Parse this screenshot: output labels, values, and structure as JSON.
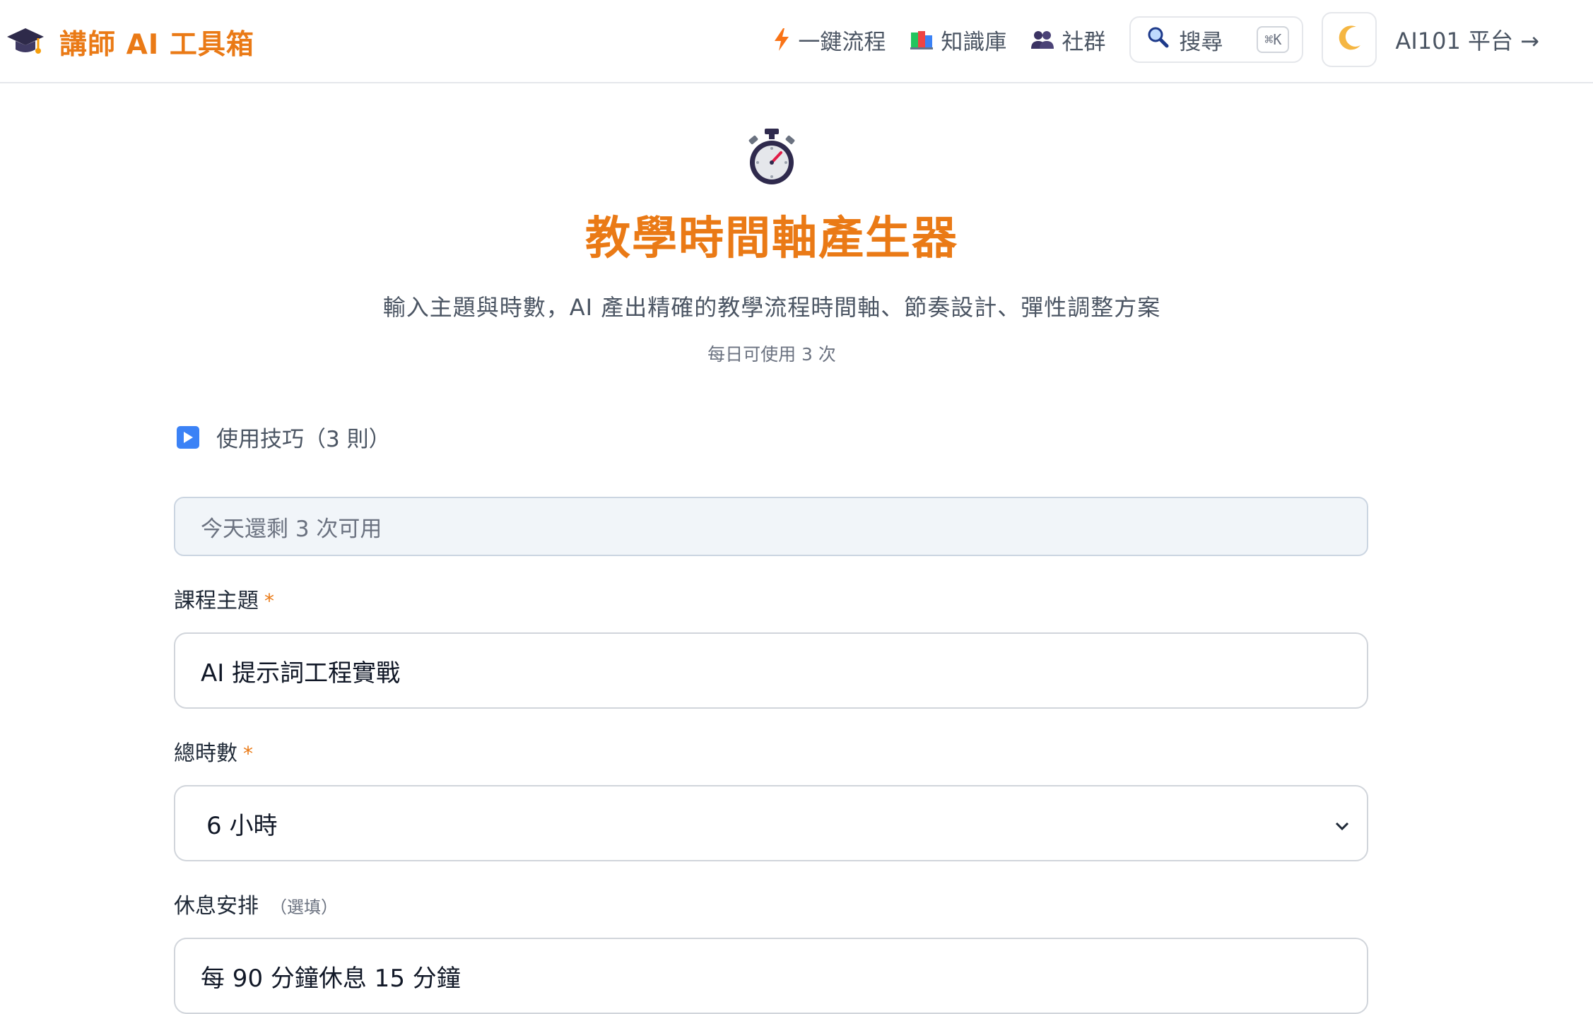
{
  "header": {
    "brand_name": "講師 AI 工具箱",
    "nav": {
      "workflow_label": "一鍵流程",
      "knowledge_label": "知識庫",
      "community_label": "社群",
      "search_label": "搜尋",
      "search_shortcut": "⌘K",
      "platform_label": "AI101 平台 →"
    },
    "icons": {
      "brand": "graduation-cap-icon",
      "workflow": "lightning-icon",
      "knowledge": "books-icon",
      "community": "people-icon",
      "search": "magnifier-icon",
      "theme": "crescent-moon-icon"
    }
  },
  "hero": {
    "icon": "stopwatch-icon",
    "title": "教學時間軸產生器",
    "subtitle": "輸入主題與時數，AI 產出精確的教學流程時間軸、節奏設計、彈性調整方案",
    "usage_note": "每日可使用 3 次"
  },
  "tips": {
    "label": "使用技巧（3 則）",
    "icon": "play-button-icon"
  },
  "quota": {
    "text": "今天還剩 3 次可用"
  },
  "form": {
    "topic": {
      "label": "課程主題",
      "required_mark": "*",
      "value": "AI 提示詞工程實戰"
    },
    "hours": {
      "label": "總時數",
      "required_mark": "*",
      "selected": "6 小時"
    },
    "breaks": {
      "label": "休息安排",
      "optional_note": "（選填）",
      "value": "每 90 分鐘休息 15 分鐘"
    }
  },
  "colors": {
    "accent": "#ea7a16",
    "text": "#374151",
    "border": "#d1d5db",
    "quota_bg": "#f1f5f9"
  }
}
